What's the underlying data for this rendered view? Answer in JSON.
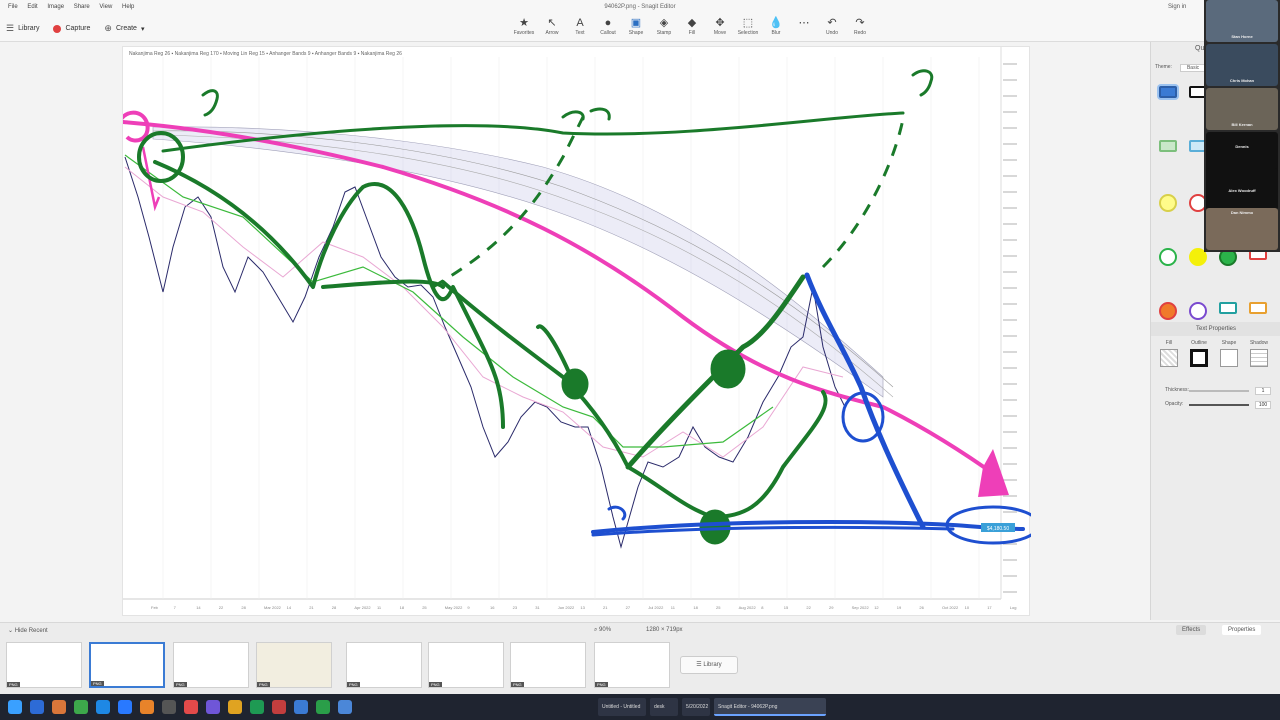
{
  "menu": {
    "items": [
      "File",
      "Edit",
      "Image",
      "Share",
      "View",
      "Help"
    ]
  },
  "window": {
    "title": "94062P.png - Snagit Editor",
    "sign_in": "Sign in"
  },
  "toolbar_left": {
    "library": "Library",
    "capture": "Capture",
    "create": "Create"
  },
  "tools": [
    {
      "label": "Favorites",
      "icon": "star-icon"
    },
    {
      "label": "Arrow",
      "icon": "arrow-icon"
    },
    {
      "label": "Text",
      "icon": "text-icon"
    },
    {
      "label": "Callout",
      "icon": "callout-icon"
    },
    {
      "label": "Shape",
      "icon": "shape-icon"
    },
    {
      "label": "Stamp",
      "icon": "stamp-icon"
    },
    {
      "label": "Fill",
      "icon": "fill-icon"
    },
    {
      "label": "Move",
      "icon": "move-icon"
    },
    {
      "label": "Selection",
      "icon": "selection-icon"
    },
    {
      "label": "Blur",
      "icon": "blur-icon"
    },
    {
      "label": "",
      "icon": "more-icon"
    },
    {
      "label": "Undo",
      "icon": "undo-icon"
    },
    {
      "label": "Redo",
      "icon": "redo-icon"
    }
  ],
  "chart": {
    "legend": "Nakanjima Reg 26 ▪ Nakanjima Reg 170 ▪ Moving Lin Reg 15 ▪ Anhanger Bands 9 ▪ Anhanger Bands 9 ▪ Nakanjima Reg 26",
    "x_ticks": [
      "Feb",
      "7",
      "14",
      "22",
      "28",
      "Mar 2022",
      "14",
      "21",
      "28",
      "Apr 2022",
      "11",
      "18",
      "25",
      "May 2022",
      "9",
      "16",
      "23",
      "31",
      "Jun 2022",
      "13",
      "21",
      "27",
      "Jul 2022",
      "11",
      "18",
      "25",
      "Aug 2022",
      "8",
      "15",
      "22",
      "29",
      "Sep 2022",
      "12",
      "19",
      "26",
      "Oct 2022",
      "10",
      "17",
      "Log"
    ],
    "price_tag": "$4,180.50",
    "annotations": [
      "?",
      "??",
      "?"
    ]
  },
  "right_panel": {
    "quick_styles_label": "Quick Styles",
    "theme_label": "Theme:",
    "theme_value": "Basic",
    "text_properties": "Text Properties",
    "props": [
      "Fill",
      "Outline",
      "Shape",
      "Shadow"
    ],
    "thickness": "Thickness:",
    "opacity": "Opacity:",
    "thickness_value": "1",
    "opacity_value": "100"
  },
  "participants": [
    {
      "name": "Stan Horne"
    },
    {
      "name": "Chris Mohan"
    },
    {
      "name": "Bill Kernan"
    },
    {
      "name": "Dennis"
    },
    {
      "name": "Alex Woodruff"
    },
    {
      "name": "Dan Nimmo"
    }
  ],
  "tray": {
    "hide_recent": "Hide Recent",
    "zoom": "90%",
    "dims": "1280 × 719px",
    "effects": "Effects",
    "properties": "Properties",
    "library": "Library",
    "thumb_tag": "PNG"
  },
  "taskbar": {
    "tasks": [
      "Untitled - Untitled",
      "desk",
      "5/20/2022",
      "Snagit Editor - 94062P.png"
    ]
  },
  "colors": {
    "accent": "#3b7bd4",
    "green_ink": "#1a7a2a",
    "blue_ink": "#1e4fd0",
    "pink_ink": "#ee3fb8"
  }
}
